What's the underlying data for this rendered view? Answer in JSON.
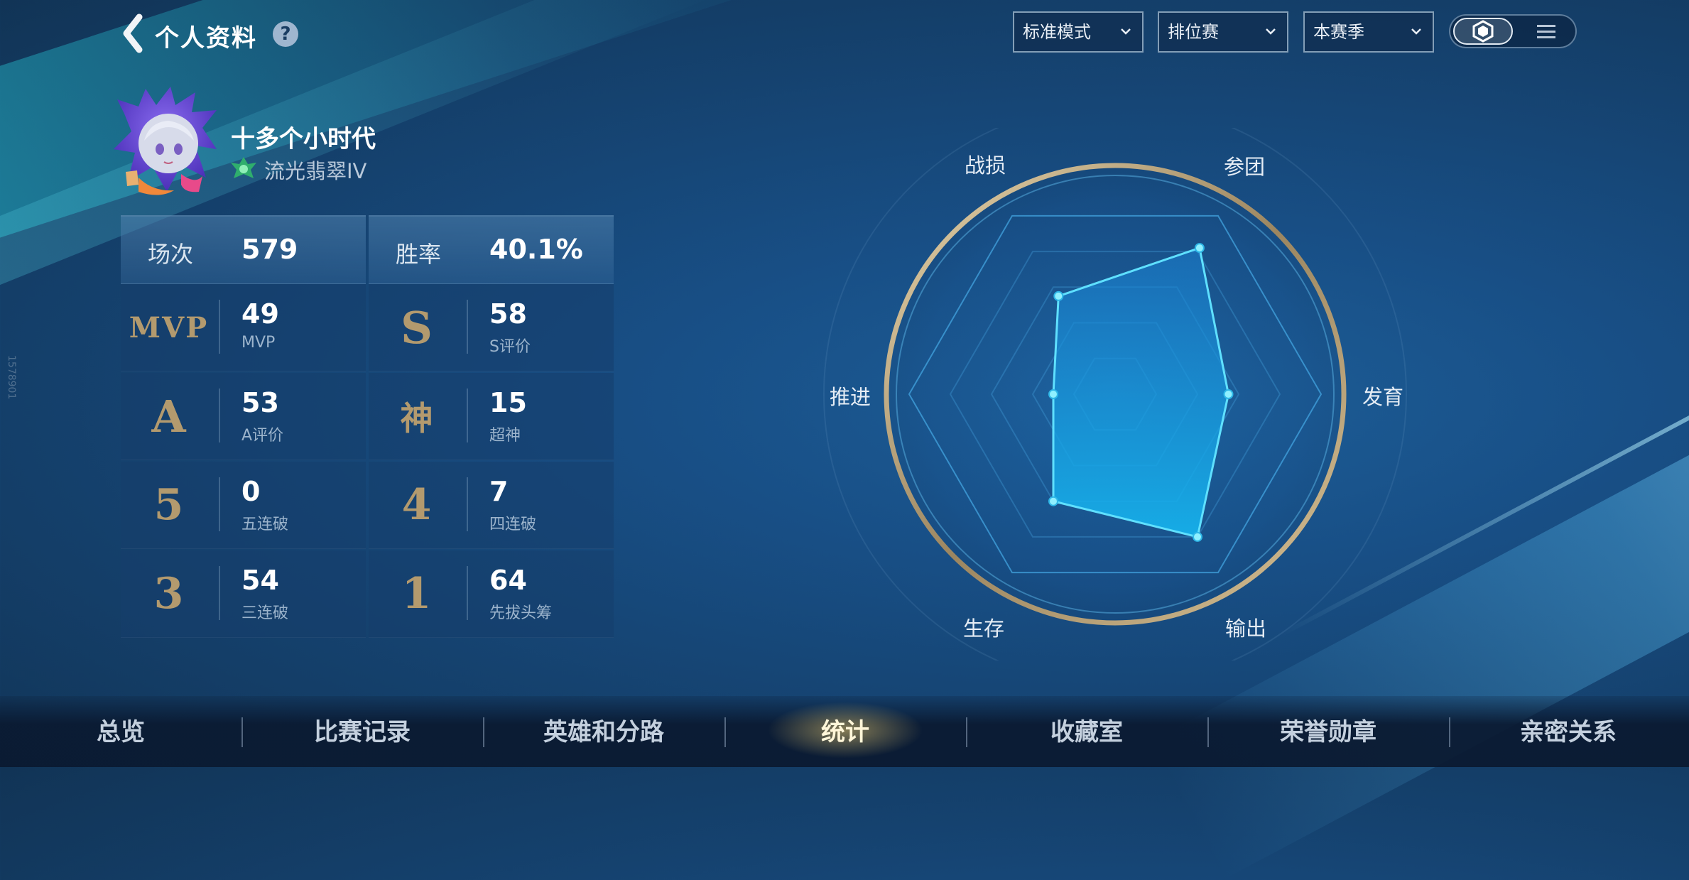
{
  "header": {
    "title": "个人资料",
    "help": "?"
  },
  "filters": {
    "mode": "标准模式",
    "match_type": "排位赛",
    "season": "本赛季"
  },
  "profile": {
    "name": "十多个小时代",
    "rank": "流光翡翠IV"
  },
  "summary": {
    "matches_label": "场次",
    "matches_value": "579",
    "winrate_label": "胜率",
    "winrate_value": "40.1%"
  },
  "stats": [
    {
      "medal": "MVP",
      "value": "49",
      "label": "MVP"
    },
    {
      "medal": "S",
      "value": "58",
      "label": "S评价"
    },
    {
      "medal": "A",
      "value": "53",
      "label": "A评价"
    },
    {
      "medal": "神",
      "value": "15",
      "label": "超神"
    },
    {
      "medal": "5",
      "value": "0",
      "label": "五连破"
    },
    {
      "medal": "4",
      "value": "7",
      "label": "四连破"
    },
    {
      "medal": "3",
      "value": "54",
      "label": "三连破"
    },
    {
      "medal": "1",
      "value": "64",
      "label": "先拔头筹"
    }
  ],
  "radar": {
    "axes": [
      "战损",
      "参团",
      "发育",
      "输出",
      "生存",
      "推进"
    ],
    "values": [
      0.55,
      0.82,
      0.55,
      0.8,
      0.6,
      0.3
    ]
  },
  "side_code": "1578901",
  "bottom_nav": {
    "items": [
      "总览",
      "比赛记录",
      "英雄和分路",
      "统计",
      "收藏室",
      "荣誉勋章",
      "亲密关系"
    ],
    "active": "统计"
  },
  "colors": {
    "accent_cyan": "#4fd8ff",
    "gold": "#b39a6e",
    "active_nav": "#fff6d8"
  }
}
